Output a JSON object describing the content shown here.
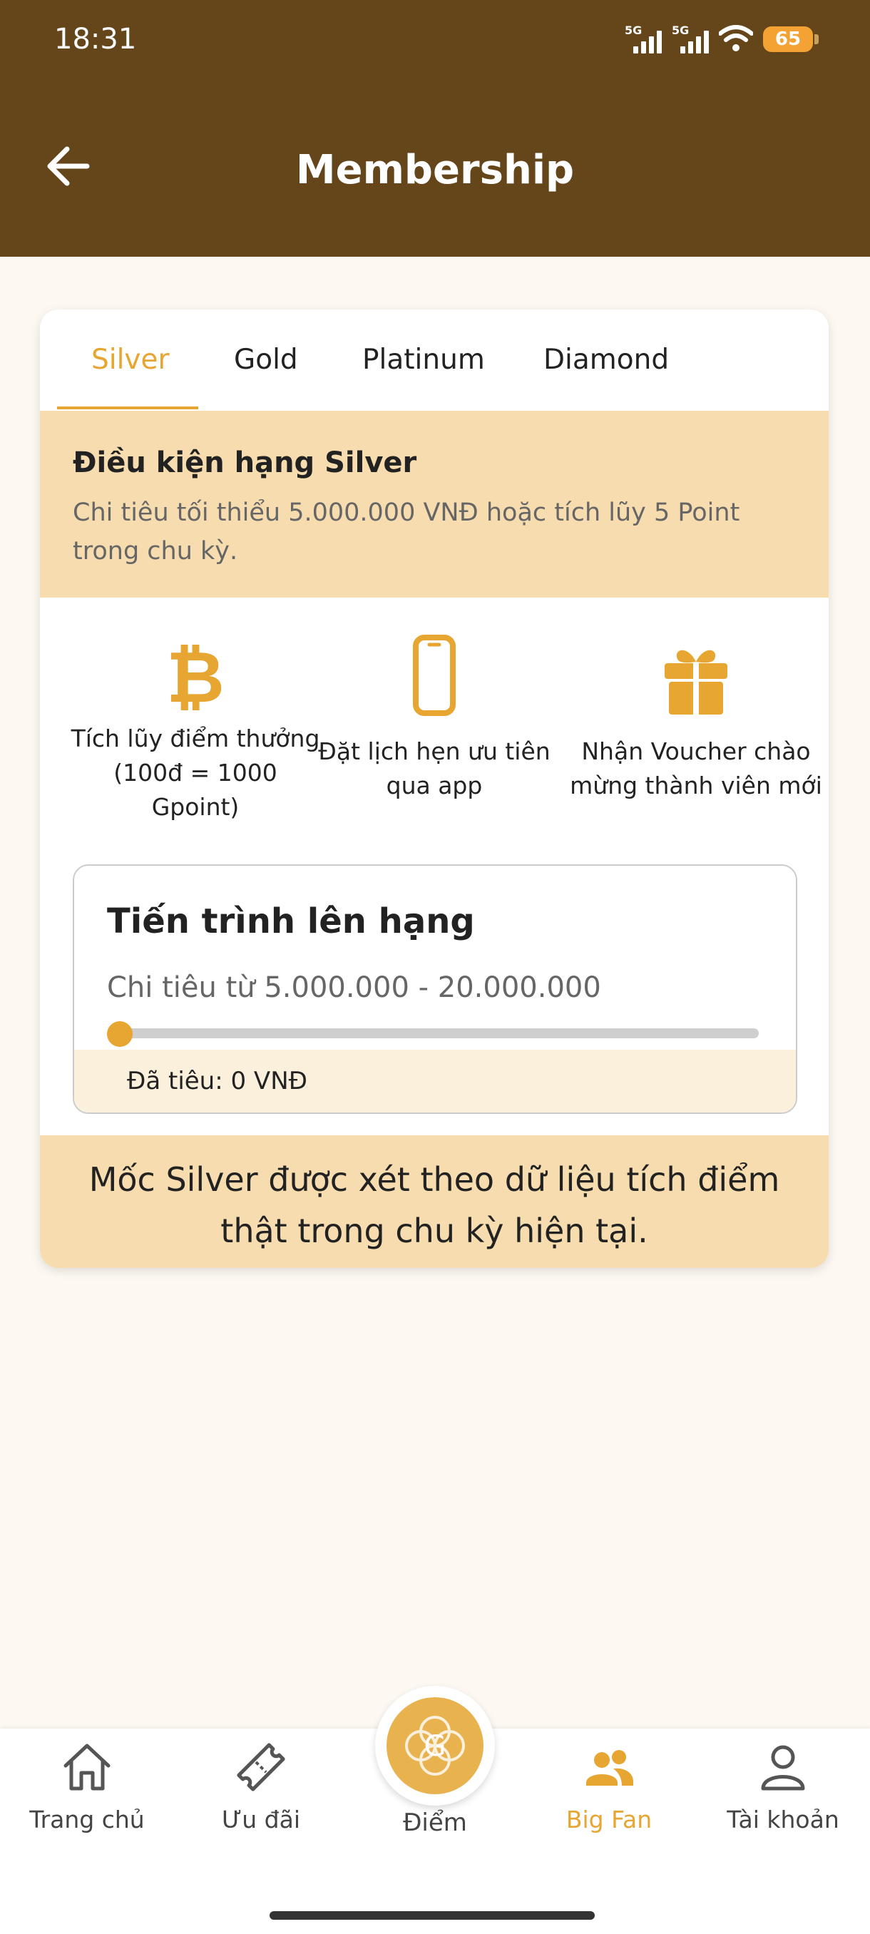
{
  "status_bar": {
    "time": "18:31",
    "network_1": "5G",
    "network_2": "5G",
    "battery": "65"
  },
  "header": {
    "title": "Membership",
    "back_icon": "arrow-left-icon"
  },
  "tabs": [
    {
      "label": "Silver",
      "active": true
    },
    {
      "label": "Gold",
      "active": false
    },
    {
      "label": "Platinum",
      "active": false
    },
    {
      "label": "Diamond",
      "active": false
    }
  ],
  "condition": {
    "title": "Điều kiện hạng Silver",
    "description": "Chi tiêu tối thiểu 5.000.000 VNĐ hoặc tích lũy 5 Point trong chu kỳ."
  },
  "benefits": [
    {
      "icon": "bitcoin-icon",
      "text": "Tích lũy điểm thưởng (100đ = 1000 Gpoint)"
    },
    {
      "icon": "smartphone-icon",
      "text": "Đặt lịch hẹn ưu tiên qua app"
    },
    {
      "icon": "gift-icon",
      "text": "Nhận Voucher chào mừng thành viên mới"
    }
  ],
  "progress": {
    "title": "Tiến trình lên hạng",
    "range": "Chi tiêu từ 5.000.000 - 20.000.000",
    "spent": "Đã tiêu: 0 VNĐ",
    "fraction": 0
  },
  "note": "Mốc Silver được xét theo dữ liệu tích điểm thật trong chu kỳ hiện tại.",
  "bottom_nav": [
    {
      "label": "Trang chủ",
      "icon": "home-icon",
      "active": false
    },
    {
      "label": "Ưu đãi",
      "icon": "ticket-icon",
      "active": false
    },
    {
      "label": "Điểm",
      "icon": "points-logo-icon",
      "active": false
    },
    {
      "label": "Big Fan",
      "icon": "users-icon",
      "active": true
    },
    {
      "label": "Tài khoản",
      "icon": "user-icon",
      "active": false
    }
  ],
  "colors": {
    "header_bg": "#65461a",
    "accent": "#e7a531",
    "highlight_bg": "#f6dcae",
    "page_bg": "#fdf8f2"
  }
}
